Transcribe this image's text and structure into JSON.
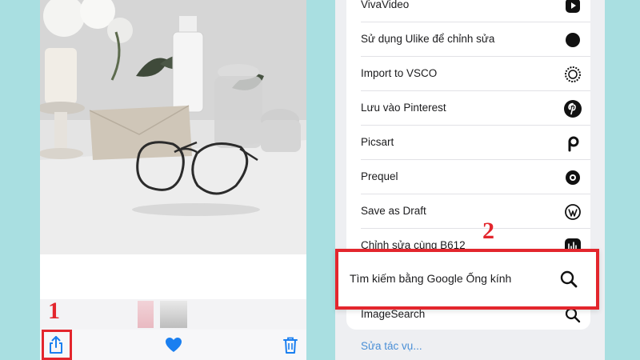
{
  "share_sheet": {
    "actions": [
      {
        "label": "VivaVideo",
        "icon": "vivavideo-icon"
      },
      {
        "label": "Sử dụng Ulike để chỉnh sửa",
        "icon": "ulike-icon"
      },
      {
        "label": "Import to VSCO",
        "icon": "vsco-icon"
      },
      {
        "label": "Lưu vào Pinterest",
        "icon": "pinterest-icon"
      },
      {
        "label": "Picsart",
        "icon": "picsart-icon"
      },
      {
        "label": "Prequel",
        "icon": "prequel-icon"
      },
      {
        "label": "Save as Draft",
        "icon": "wordpress-icon"
      },
      {
        "label": "Chỉnh sửa cùng B612",
        "icon": "b612-icon"
      },
      {
        "label": "Tìm kiếm bằng Google Ống kính",
        "icon": "search-icon"
      },
      {
        "label": "ImageSearch",
        "icon": "search-icon"
      }
    ],
    "more_actions_label": "Sửa tác vụ..."
  },
  "annotations": {
    "step_1": "1",
    "step_2": "2",
    "highlight_color": "#e3262d"
  },
  "photos_toolbar": {
    "share_icon": "share-icon",
    "favorite_icon": "heart-icon",
    "delete_icon": "trash-icon",
    "accent_color": "#1a7ff0"
  }
}
